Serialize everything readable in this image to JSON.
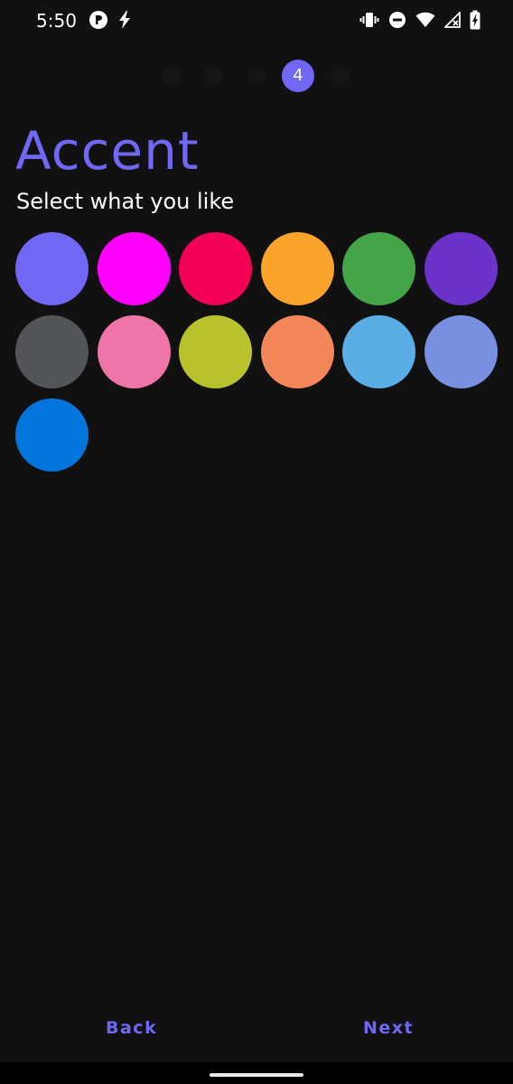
{
  "status_bar": {
    "time": "5:50",
    "left_icons": [
      "app-notification-icon",
      "flash-icon"
    ],
    "right_icons": [
      "vibrate-icon",
      "do-not-disturb-icon",
      "wifi-icon",
      "no-signal-icon",
      "battery-charging-icon"
    ]
  },
  "steps": {
    "count": 5,
    "current": 4,
    "current_label": "4",
    "active_color": "#7068f4",
    "inactive_color": "#161616"
  },
  "header": {
    "title": "Accent",
    "subtitle": "Select what you like"
  },
  "colors": {
    "accent": "#7068f4",
    "swatches": [
      "#7068f4",
      "#ff00ff",
      "#f50057",
      "#faa42b",
      "#43a547",
      "#6c33cb",
      "#535559",
      "#ef74a7",
      "#b8c32c",
      "#f3875a",
      "#5aaee5",
      "#7890df",
      "#0275dc"
    ]
  },
  "footer": {
    "back_label": "Back",
    "next_label": "Next"
  }
}
